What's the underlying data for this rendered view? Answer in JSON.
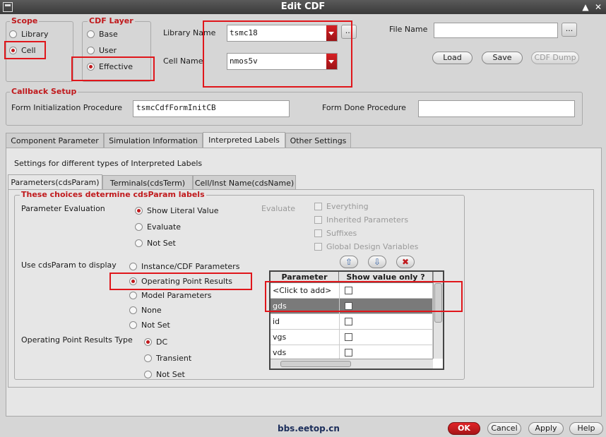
{
  "window": {
    "title": "Edit CDF",
    "restore_glyph": "▲",
    "close_glyph": "✕"
  },
  "scope": {
    "title": "Scope",
    "options": [
      "Library",
      "Cell"
    ],
    "selected": "Cell"
  },
  "cdf_layer": {
    "title": "CDF Layer",
    "options": [
      "Base",
      "User",
      "Effective"
    ],
    "selected": "Effective"
  },
  "library": {
    "label": "Library Name",
    "value": "tsmc18",
    "browse": "..."
  },
  "cell": {
    "label": "Cell Name",
    "value": "nmos5v"
  },
  "file": {
    "label": "File Name",
    "value": "",
    "browse": "..."
  },
  "file_buttons": {
    "load": "Load",
    "save": "Save",
    "cdf_dump": "CDF Dump"
  },
  "callback": {
    "title": "Callback Setup",
    "init_label": "Form Initialization Procedure",
    "init_value": "tsmcCdfFormInitCB",
    "done_label": "Form Done Procedure",
    "done_value": ""
  },
  "main_tabs": [
    "Component Parameter",
    "Simulation Information",
    "Interpreted Labels",
    "Other Settings"
  ],
  "main_tab_active": "Interpreted Labels",
  "settings_caption": "Settings for different types of Interpreted Labels",
  "sub_tabs": [
    "Parameters(cdsParam)",
    "Terminals(cdsTerm)",
    "Cell/Inst Name(cdsName)"
  ],
  "sub_tab_active": "Parameters(cdsParam)",
  "choices": {
    "title": "These choices determine cdsParam labels",
    "param_eval": {
      "label": "Parameter Evaluation",
      "options": [
        "Show Literal Value",
        "Evaluate",
        "Not Set"
      ],
      "selected": "Show Literal Value"
    },
    "evaluate": {
      "label": "Evaluate",
      "options": [
        "Everything",
        "Inherited Parameters",
        "Suffixes",
        "Global Design Variables"
      ]
    },
    "display": {
      "label": "Use cdsParam to display",
      "options": [
        "Instance/CDF Parameters",
        "Operating Point Results",
        "Model Parameters",
        "None",
        "Not Set"
      ],
      "selected": "Operating Point Results"
    },
    "op_type": {
      "label": "Operating Point Results Type",
      "options": [
        "DC",
        "Transient",
        "Not Set"
      ],
      "selected": "DC"
    }
  },
  "list_buttons": {
    "up": "⇧",
    "down": "⇩",
    "delete": "✖"
  },
  "param_table": {
    "columns": [
      "Parameter",
      "Show value only ?"
    ],
    "rows": [
      {
        "name": "<Click to add>",
        "checked": false
      },
      {
        "name": "gds",
        "checked": false
      },
      {
        "name": "id",
        "checked": false
      },
      {
        "name": "vgs",
        "checked": false
      },
      {
        "name": "vds",
        "checked": false
      }
    ],
    "selected_row": "gds"
  },
  "watermark": "bbs.eetop.cn",
  "footer": {
    "ok": "OK",
    "cancel": "Cancel",
    "apply": "Apply",
    "help": "Help"
  },
  "colors": {
    "accent": "#c0191c",
    "highlight_box": "#e0161b"
  }
}
